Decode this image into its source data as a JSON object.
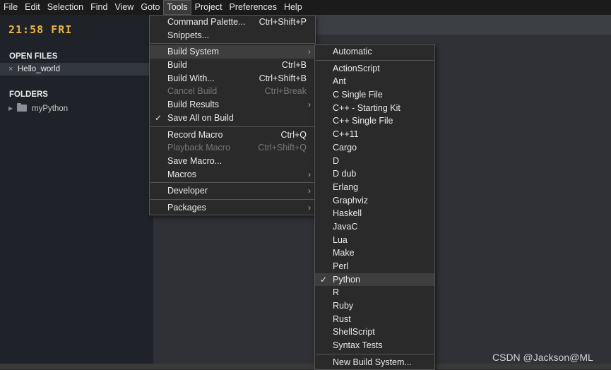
{
  "menubar": {
    "items": [
      "File",
      "Edit",
      "Selection",
      "Find",
      "View",
      "Goto",
      "Tools",
      "Project",
      "Preferences",
      "Help"
    ]
  },
  "sidebar": {
    "clock": "21:58 FRI",
    "open_files_title": "OPEN FILES",
    "open_file": {
      "close_glyph": "×",
      "name": "Hello_world"
    },
    "folders_title": "FOLDERS",
    "folder": {
      "name": "myPython"
    }
  },
  "tools_menu": {
    "items": [
      {
        "label": "Command Palette...",
        "shortcut": "Ctrl+Shift+P"
      },
      {
        "label": "Snippets...",
        "shortcut": ""
      },
      {
        "label": "Build System",
        "shortcut": "",
        "submenu": true,
        "highlighted": true
      },
      {
        "label": "Build",
        "shortcut": "Ctrl+B"
      },
      {
        "label": "Build With...",
        "shortcut": "Ctrl+Shift+B"
      },
      {
        "label": "Cancel Build",
        "shortcut": "Ctrl+Break",
        "disabled": true
      },
      {
        "label": "Build Results",
        "shortcut": "",
        "submenu": true
      },
      {
        "label": "Save All on Build",
        "shortcut": "",
        "checked": true
      },
      {
        "label": "Record Macro",
        "shortcut": "Ctrl+Q"
      },
      {
        "label": "Playback Macro",
        "shortcut": "Ctrl+Shift+Q",
        "disabled": true
      },
      {
        "label": "Save Macro...",
        "shortcut": ""
      },
      {
        "label": "Macros",
        "shortcut": "",
        "submenu": true
      },
      {
        "label": "Developer",
        "shortcut": "",
        "submenu": true
      },
      {
        "label": "Packages",
        "shortcut": "",
        "submenu": true
      }
    ]
  },
  "build_menu": {
    "automatic": "Automatic",
    "items": [
      "ActionScript",
      "Ant",
      "C Single File",
      "C++ - Starting Kit",
      "C++ Single File",
      "C++11",
      "Cargo",
      "D",
      "D dub",
      "Erlang",
      "Graphviz",
      "Haskell",
      "JavaC",
      "Lua",
      "Make",
      "Perl",
      "Python",
      "R",
      "Ruby",
      "Rust",
      "ShellScript",
      "Syntax Tests"
    ],
    "selected": "Python",
    "new_build_system": "New Build System..."
  },
  "watermark": "CSDN @Jackson@ML"
}
